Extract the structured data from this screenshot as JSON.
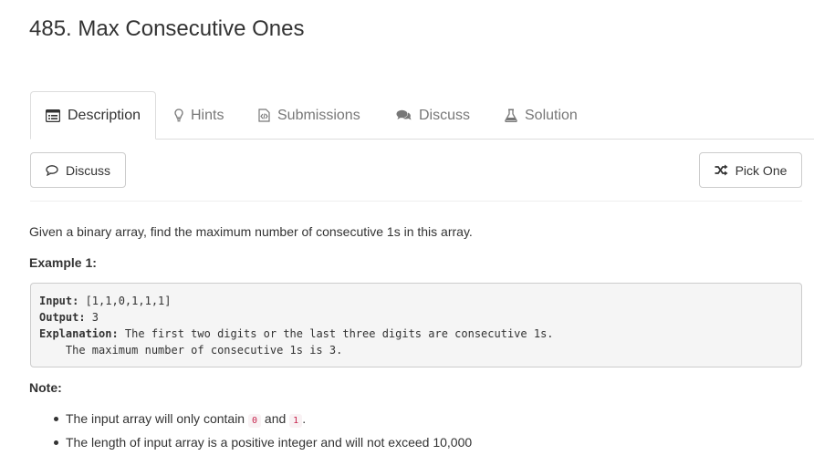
{
  "title": "485. Max Consecutive Ones",
  "tabs": [
    {
      "label": "Description",
      "icon": "list-icon"
    },
    {
      "label": "Hints",
      "icon": "lightbulb-icon"
    },
    {
      "label": "Submissions",
      "icon": "code-file-icon"
    },
    {
      "label": "Discuss",
      "icon": "comments-icon"
    },
    {
      "label": "Solution",
      "icon": "flask-icon"
    }
  ],
  "toolbar": {
    "discuss_label": "Discuss",
    "pick_one_label": "Pick One"
  },
  "problem": {
    "description": "Given a binary array, find the maximum number of consecutive 1s in this array.",
    "example_heading": "Example 1:",
    "example": {
      "input_label": "Input:",
      "input_value": " [1,1,0,1,1,1]",
      "output_label": "Output:",
      "output_value": " 3",
      "explanation_label": "Explanation:",
      "explanation_line1": " The first two digits or the last three digits are consecutive 1s.",
      "explanation_line2": "    The maximum number of consecutive 1s is 3."
    },
    "note_heading": "Note:",
    "notes": {
      "n1_before": "The input array will only contain ",
      "n1_code1": "0",
      "n1_mid": " and ",
      "n1_code2": "1",
      "n1_after": ".",
      "n2": "The length of input array is a positive integer and will not exceed 10,000"
    }
  }
}
